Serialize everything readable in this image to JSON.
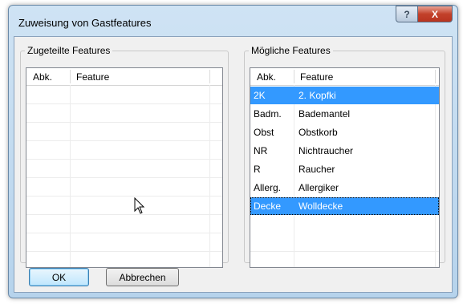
{
  "dialog": {
    "title": "Zuweisung von Gastfeatures",
    "help_glyph": "?",
    "close_glyph": "X"
  },
  "left_group": {
    "legend": "Zugeteilte Features",
    "columns": [
      "Abk.",
      "Feature"
    ],
    "rows": []
  },
  "right_group": {
    "legend": "Mögliche Features",
    "columns": [
      "Abk.",
      "Feature"
    ],
    "rows": [
      {
        "abbr": "2K",
        "feature": "2. Kopfki",
        "selected": true
      },
      {
        "abbr": "Badm.",
        "feature": "Bademantel",
        "selected": false
      },
      {
        "abbr": "Obst",
        "feature": "Obstkorb",
        "selected": false
      },
      {
        "abbr": "NR",
        "feature": "Nichtraucher",
        "selected": false
      },
      {
        "abbr": "R",
        "feature": "Raucher",
        "selected": false
      },
      {
        "abbr": "Allerg.",
        "feature": "Allergiker",
        "selected": false
      },
      {
        "abbr": "Decke",
        "feature": "Wolldecke",
        "selected": true
      }
    ]
  },
  "buttons": {
    "ok": "OK",
    "cancel": "Abbrechen"
  },
  "colors": {
    "selection": "#3399ff",
    "title_bar": "#b6d3ec",
    "close_button": "#c2412a"
  }
}
